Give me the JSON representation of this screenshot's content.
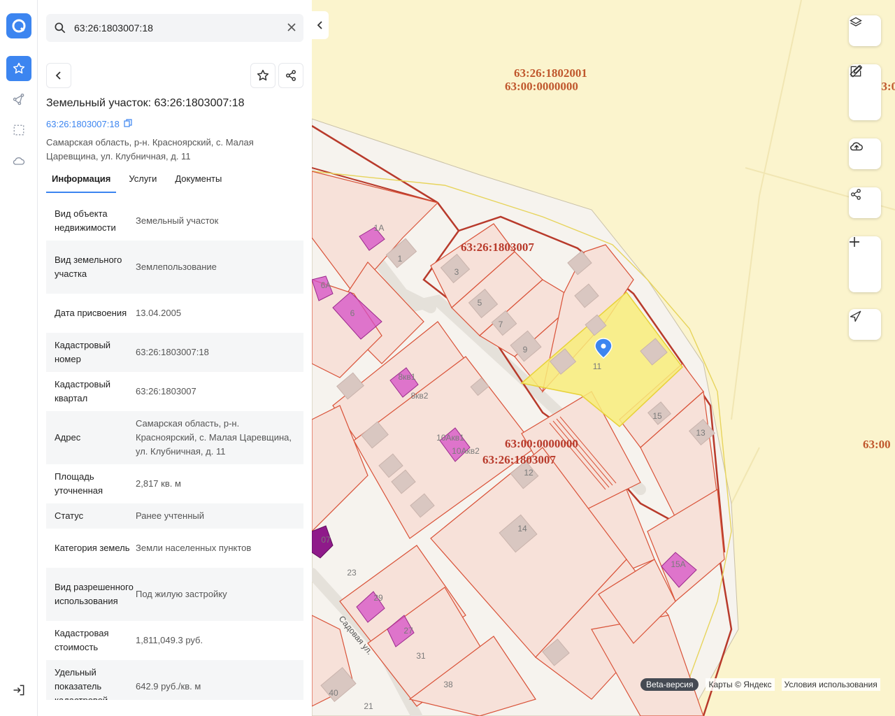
{
  "rail": {
    "logo": "logo-icon",
    "items": [
      {
        "name": "favorites-icon",
        "active": true
      },
      {
        "name": "route-icon"
      },
      {
        "name": "selection-icon"
      },
      {
        "name": "cloud-icon"
      }
    ],
    "logout": "logout-icon"
  },
  "search": {
    "value": "63:26:1803007:18"
  },
  "object": {
    "title": "Земельный участок: 63:26:1803007:18",
    "cad_link": "63:26:1803007:18",
    "address": "Самарская область, р-н. Красноярский, с. Малая Царевщина, ул. Клубничная, д. 11"
  },
  "tabs": [
    {
      "label": "Информация",
      "active": true
    },
    {
      "label": "Услуги"
    },
    {
      "label": "Документы"
    }
  ],
  "info": [
    {
      "k": "Вид объекта недвижимости",
      "v": "Земельный участок"
    },
    {
      "k": "Вид земельного участка",
      "v": "Землепользование"
    },
    {
      "k": "Дата присвоения",
      "v": "13.04.2005"
    },
    {
      "k": "Кадастровый номер",
      "v": "63:26:1803007:18"
    },
    {
      "k": "Кадастровый квартал",
      "v": "63:26:1803007"
    },
    {
      "k": "Адрес",
      "v": "Самарская область, р-н. Красноярский, с. Малая Царевщина, ул. Клубничная, д. 11"
    },
    {
      "k": "Площадь уточненная",
      "v": "2,817 кв. м"
    },
    {
      "k": "Статус",
      "v": "Ранее учтенный"
    },
    {
      "k": "Категория земель",
      "v": "Земли населенных пунктов"
    },
    {
      "k": "Вид разрешенного использования",
      "v": "Под жилую застройку"
    },
    {
      "k": "Кадастровая стоимость",
      "v": "1,811,049.3 руб."
    },
    {
      "k": "Удельный показатель кадастровой",
      "v": "642.9 руб./кв. м"
    }
  ],
  "map": {
    "labels": {
      "q1": "63:26:1802001",
      "q2": "63:00:0000000",
      "q3": "63:26:1803007",
      "q4": "63:00:0000000",
      "q5": "63:26:1803007",
      "edge1": "63:0",
      "edge2": "63:00"
    },
    "street": "Садовая ул.",
    "lots": [
      "1",
      "1А",
      "3",
      "5",
      "7",
      "9",
      "11",
      "15",
      "13",
      "12",
      "14",
      "15А",
      "6А",
      "6",
      "8кв1",
      "8кв2",
      "10Акв1",
      "10Акв2",
      "23",
      "29",
      "27",
      "31",
      "38",
      "40",
      "21",
      "07"
    ],
    "colors": {
      "accent": "#3c85f0",
      "quarter_border": "#b83a2b",
      "lot_fill": "#f7e1d9",
      "building": "#d9c7c1",
      "selected": "#f8ec7a",
      "pink": "#d54fc6"
    }
  },
  "map_controls": [
    "layers-icon",
    "ruler-icon",
    "edit-icon",
    "upload-icon",
    "share-icon",
    "zoom-in-icon",
    "zoom-out-icon",
    "locate-icon"
  ],
  "attribution": {
    "beta": "Beta-версия",
    "maps": "Карты © Яндекс",
    "terms": "Условия использования"
  }
}
